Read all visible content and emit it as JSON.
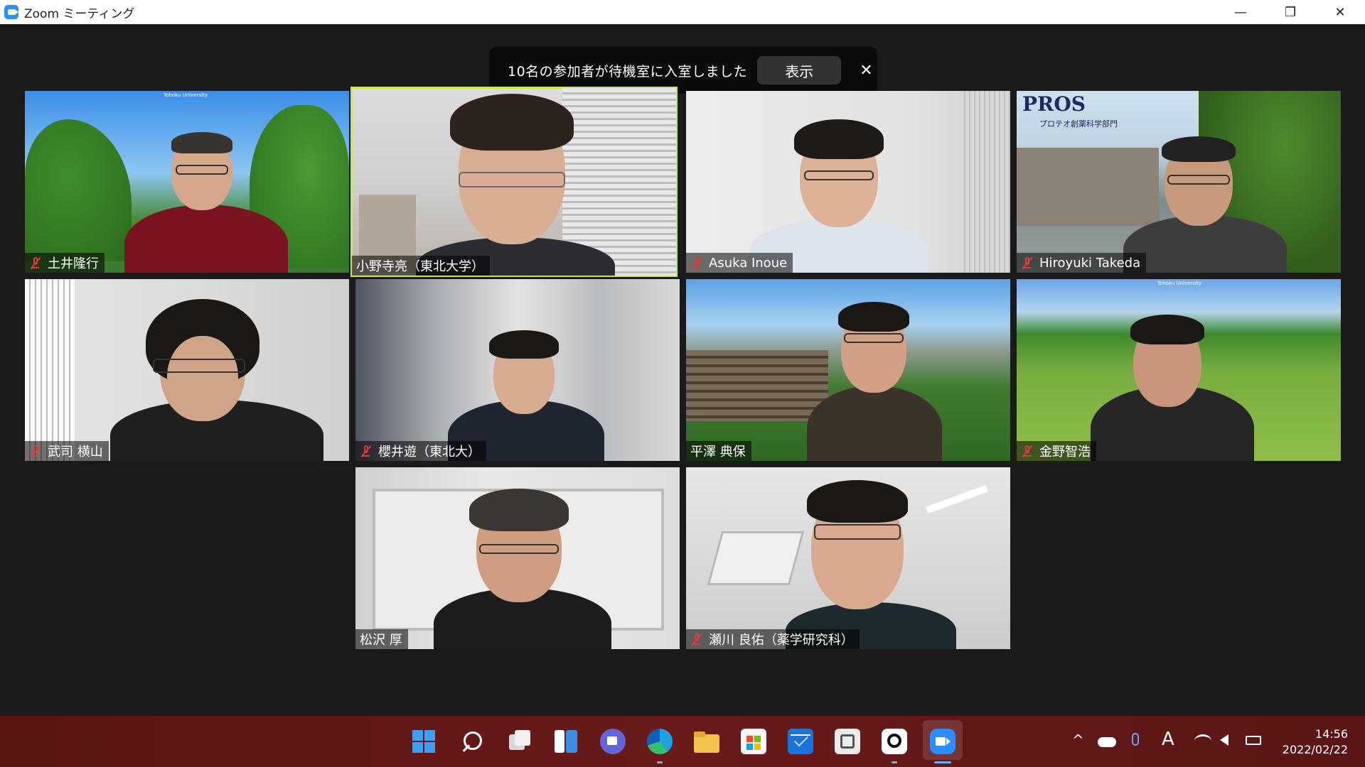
{
  "window": {
    "title": "Zoom ミーティング",
    "controls": {
      "minimize": "—",
      "restore": "❐",
      "close": "✕"
    }
  },
  "banner": {
    "message": "10名の参加者が待機室に入室しました",
    "show_button": "表示",
    "close": "✕"
  },
  "participants": [
    {
      "name": "土井隆行",
      "muted": true
    },
    {
      "name": "小野寺亮（東北大学）",
      "muted": false,
      "active": true
    },
    {
      "name": "Asuka Inoue",
      "muted": true
    },
    {
      "name": "Hiroyuki Takeda",
      "muted": true
    },
    {
      "name": "武司 横山",
      "muted": true
    },
    {
      "name": "櫻井遊（東北大）",
      "muted": true
    },
    {
      "name": "平澤 典保",
      "muted": false
    },
    {
      "name": "金野智浩",
      "muted": true
    },
    {
      "name": "松沢 厚",
      "muted": false
    },
    {
      "name": "瀬川 良佑（薬学研究科）",
      "muted": true
    }
  ],
  "tile_backgrounds": {
    "pros_logo": "PROS",
    "pros_sub": "プロテオ創薬科学部門",
    "tohoku_small": "Tohoku University"
  },
  "taskbar": {
    "apps": [
      "start-icon",
      "search-icon",
      "task-view-icon",
      "widgets-icon",
      "teams-chat-icon",
      "edge-icon",
      "file-explorer-icon",
      "store-icon",
      "mail-icon",
      "photos-icon",
      "app-icon",
      "zoom-icon"
    ],
    "tray": {
      "chevron": "^",
      "ime": "A"
    },
    "time": "14:56",
    "date": "2022/02/22"
  },
  "colors": {
    "active_border": "#c5e84a",
    "mute_red": "#e03a3a",
    "taskbar": "#5a1414"
  }
}
